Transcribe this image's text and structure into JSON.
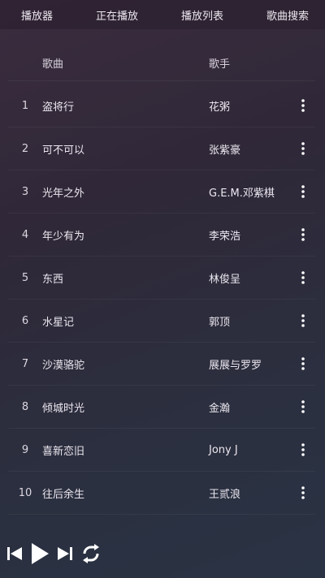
{
  "tabs": [
    {
      "label": "播放器"
    },
    {
      "label": "正在播放"
    },
    {
      "label": "播放列表"
    },
    {
      "label": "歌曲搜索"
    }
  ],
  "header": {
    "song": "歌曲",
    "artist": "歌手"
  },
  "songs": [
    {
      "index": "1",
      "title": "盗将行",
      "artist": "花粥"
    },
    {
      "index": "2",
      "title": "可不可以",
      "artist": "张紫豪"
    },
    {
      "index": "3",
      "title": "光年之外",
      "artist": "G.E.M.邓紫棋"
    },
    {
      "index": "4",
      "title": "年少有为",
      "artist": "李荣浩"
    },
    {
      "index": "5",
      "title": "东西",
      "artist": "林俊呈"
    },
    {
      "index": "6",
      "title": "水星记",
      "artist": "郭顶"
    },
    {
      "index": "7",
      "title": "沙漠骆驼",
      "artist": "展展与罗罗"
    },
    {
      "index": "8",
      "title": "倾城时光",
      "artist": "金瀚"
    },
    {
      "index": "9",
      "title": "喜新恋旧",
      "artist": "Jony J"
    },
    {
      "index": "10",
      "title": "往后余生",
      "artist": "王贰浪"
    }
  ],
  "icons": {
    "row_menu": "more-vertical-icon",
    "prev": "skip-previous-icon",
    "play": "play-icon",
    "next": "skip-next-icon",
    "repeat": "repeat-icon"
  },
  "colors": {
    "text": "#ece7ef",
    "icon": "#ffffff"
  }
}
